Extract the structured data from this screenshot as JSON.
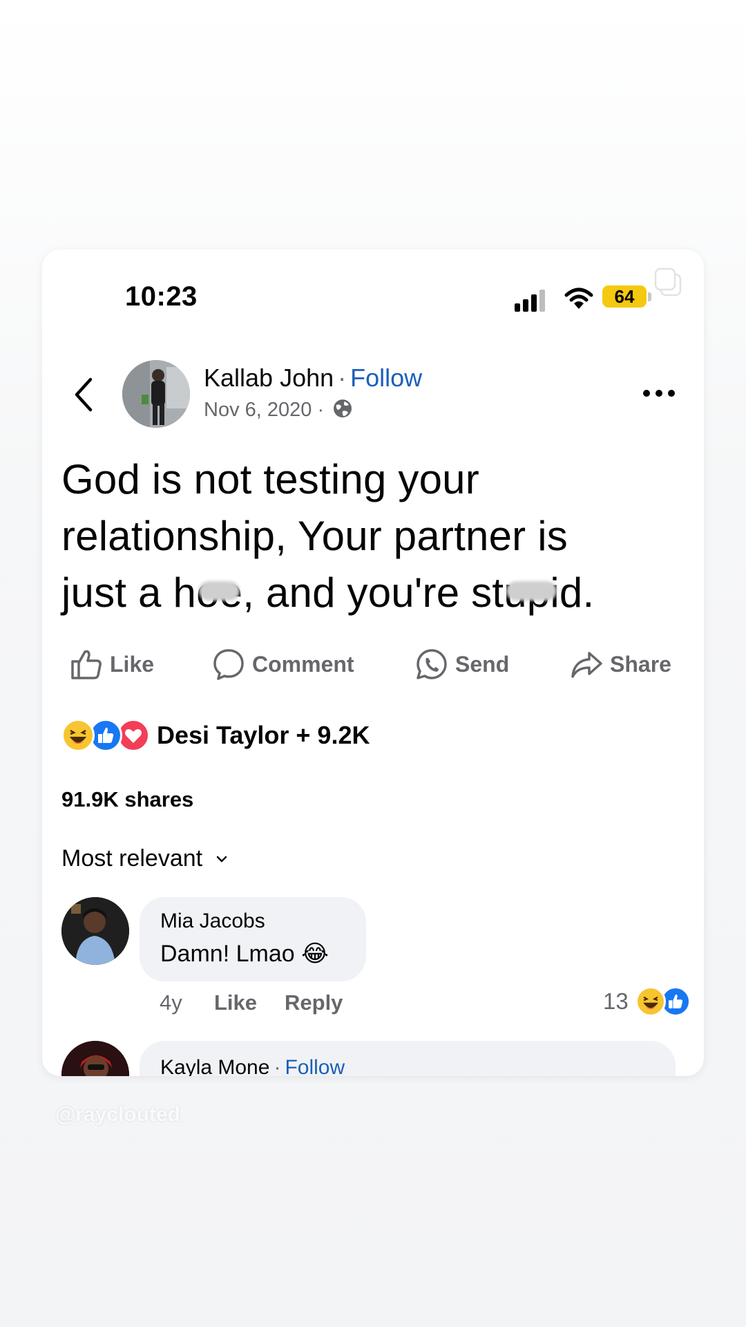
{
  "status_bar": {
    "time": "10:23",
    "battery": "64"
  },
  "post": {
    "author": "Kallab John",
    "separator": "·",
    "follow_label": "Follow",
    "date": "Nov 6, 2020",
    "date_separator": "·",
    "text_line1": "God is not testing your",
    "text_line2": "relationship, Your partner is",
    "text_line3_a": "just a h",
    "text_line3_masked_1": "oe",
    "text_line3_b": ", and you're st",
    "text_line3_masked_2": "upi",
    "text_line3_c": "d."
  },
  "actions": {
    "like": "Like",
    "comment": "Comment",
    "send": "Send",
    "share": "Share"
  },
  "reactions": {
    "icons": [
      "haha-icon",
      "like-icon",
      "love-icon"
    ],
    "summary": "Desi Taylor + 9.2K"
  },
  "shares": "91.9K shares",
  "sort": {
    "label": "Most relevant"
  },
  "comments": [
    {
      "name": "Mia Jacobs",
      "text": "Damn! Lmao",
      "emoji": "😂",
      "time": "4y",
      "like": "Like",
      "reply": "Reply",
      "reaction_count": "13"
    },
    {
      "name": "Kayla Mone",
      "separator": "·",
      "follow_label": "Follow"
    }
  ],
  "watermark": "@rayclouted",
  "colors": {
    "follow": "#1b5fb8",
    "battery": "#f5c90f",
    "secondary_text": "#65676b",
    "bubble": "#f0f2f5",
    "like_blue": "#1877f2",
    "love_red": "#f33e58",
    "haha_yellow": "#f7c531"
  }
}
